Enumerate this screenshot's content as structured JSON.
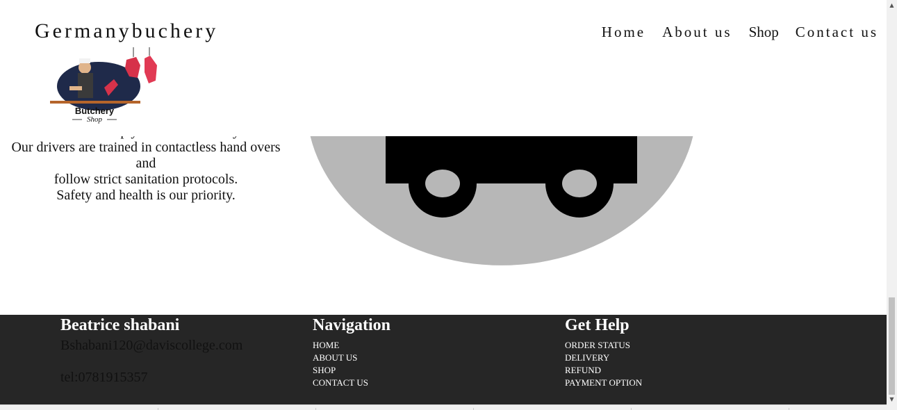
{
  "header": {
    "brand": "Germanybuchery",
    "nav": [
      {
        "label": "Home"
      },
      {
        "label": "About us"
      },
      {
        "label": "Shop"
      },
      {
        "label": "Contact us"
      }
    ],
    "logo": {
      "line1": "Butchery",
      "line2": "Shop"
    }
  },
  "content": {
    "lines": [
      "the curve and keep yourself and family safe.",
      "Our drivers are trained in contactless hand overs and",
      "follow strict sanitation protocols.",
      "Safety and health is our priority."
    ]
  },
  "footer": {
    "col1": {
      "title": "Beatrice shabani",
      "email": "Bshabani120@daviscollege.com",
      "phone": "tel:0781915357"
    },
    "col2": {
      "title": "Navigation",
      "links": [
        "HOME",
        "ABOUT US",
        "SHOP",
        "CONTACT US"
      ]
    },
    "col3": {
      "title": "Get Help",
      "links": [
        "ORDER STATUS",
        "DELIVERY",
        "REFUND",
        "PAYMENT OPTION"
      ]
    }
  },
  "scrollbar": {
    "up_icon": "arrow-up-icon",
    "down_icon": "arrow-down-icon"
  }
}
